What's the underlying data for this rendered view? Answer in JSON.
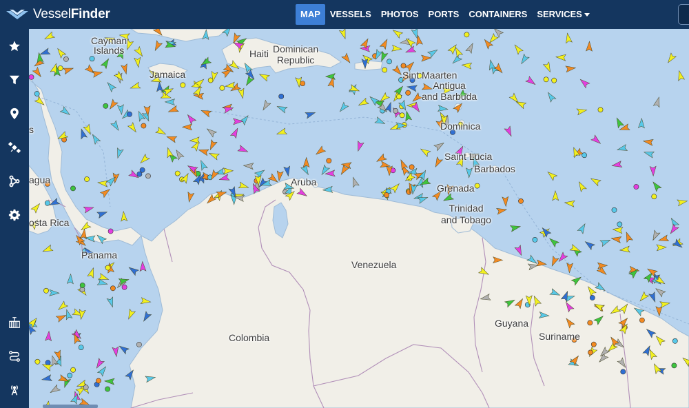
{
  "brand": {
    "name_light": "Vessel",
    "name_bold": "Finder"
  },
  "nav": {
    "items": [
      {
        "label": "MAP",
        "active": true
      },
      {
        "label": "VESSELS",
        "active": false
      },
      {
        "label": "PHOTOS",
        "active": false
      },
      {
        "label": "PORTS",
        "active": false
      },
      {
        "label": "CONTAINERS",
        "active": false
      },
      {
        "label": "SERVICES",
        "active": false,
        "dropdown": true
      }
    ]
  },
  "sidebar": {
    "items": [
      {
        "icon": "star-icon",
        "name": "favorites"
      },
      {
        "icon": "filter-icon",
        "name": "filter"
      },
      {
        "icon": "map-pin-icon",
        "name": "ports"
      },
      {
        "icon": "satellite-icon",
        "name": "satellite"
      },
      {
        "icon": "route-icon",
        "name": "routes"
      },
      {
        "icon": "gear-icon",
        "name": "settings"
      },
      {
        "icon": "container-icon",
        "name": "containers"
      },
      {
        "icon": "route-planner-icon",
        "name": "route-planner"
      },
      {
        "icon": "antenna-icon",
        "name": "ais-stations"
      }
    ]
  },
  "map": {
    "labels": {
      "cayman": "Cayman\nIslands",
      "haiti": "Haiti",
      "dominican": "Dominican\nRepublic",
      "jamaica": "Jamaica",
      "sint_maarten": "Sint Maarten",
      "antigua": "Antigua\nand Barbuda",
      "dominica": "Dominica",
      "saint_lucia": "Saint Lucia",
      "barbados": "Barbados",
      "grenada": "Grenada",
      "trinidad": "Trinidad\nand Tobago",
      "aruba": "Aruba",
      "venezuela": "Venezuela",
      "panama": "Panama",
      "costa_rica": "osta Rica",
      "nicaragua": "agua",
      "colombia": "Colombia",
      "guyana": "Guyana",
      "suriname": "Suriname",
      "bahamas_fragment": "s"
    },
    "colors": {
      "sea": "#b7d3ee",
      "land": "#f1efe8",
      "border": "#b18fb8",
      "cargo": "#f2f01f",
      "tanker": "#f28a22",
      "passenger": "#2f6fd3",
      "tug": "#58c8e8",
      "fishing": "#3ec43e",
      "pleasure": "#e43ee0",
      "other": "#b0b0b0"
    }
  }
}
